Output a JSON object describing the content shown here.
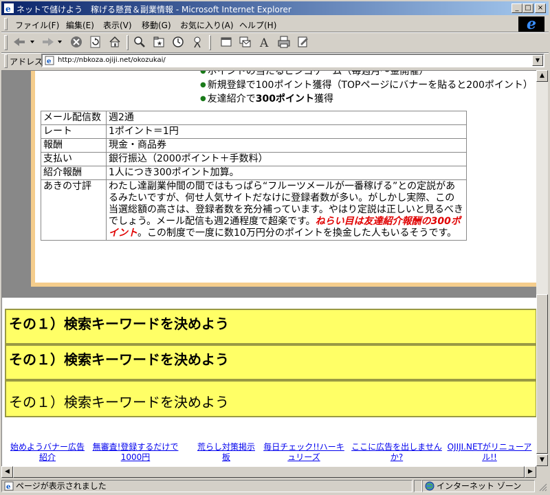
{
  "window": {
    "title": "ネットで儲けよう　稼げる懸賞＆副業情報 - Microsoft Internet Explorer",
    "min_glyph": "_",
    "max_glyph": "□",
    "close_glyph": "×"
  },
  "menu": {
    "items": [
      "ファイル(F)",
      "編集(E)",
      "表示(V)",
      "移動(G)",
      "お気に入り(A)",
      "ヘルプ(H)"
    ]
  },
  "toolbar": {
    "icons": [
      "back-icon",
      "forward-icon",
      "stop-icon",
      "refresh-icon",
      "home-icon",
      "search-icon",
      "favorites-icon",
      "history-icon",
      "channels-icon",
      "fullscreen-icon",
      "mail-icon",
      "font-icon",
      "print-icon",
      "edit-icon"
    ]
  },
  "address": {
    "label": "アドレス",
    "url": "http://nbkoza.ojiji.net/okozukai/"
  },
  "content": {
    "bullets": [
      "ポイントの当たるビンゴゲーム（毎週月～金開催）",
      "新規登録で100ポイント獲得（TOPページにバナーを貼ると200ポイント）",
      "友達紹介で300ポイント獲得"
    ],
    "bullet3_pre": "友達紹介で",
    "bullet3_bold": "300ポイント",
    "bullet3_post": "獲得",
    "table": [
      {
        "key": "メール配信数",
        "value": "週2通"
      },
      {
        "key": "レート",
        "value": "1ポイント＝1円"
      },
      {
        "key": "報酬",
        "value": "現金・商品券"
      },
      {
        "key": "支払い",
        "value": "銀行振込（2000ポイント＋手数料）"
      },
      {
        "key": "紹介報酬",
        "value": "1人につき300ポイント加算。"
      }
    ],
    "review_key": "あきの寸評",
    "review_pre": "わたし達副業仲間の間ではもっぱら“フルーツメールが一番稼げる”との定説があるみたいですが、何せ人気サイトだなけに登録者数が多い。がしかし実際、この当選総額の高さは、登録者数を充分補っています。やはり定説は正しいと見るべきでしょう。メール配信も週2通程度で超楽です。",
    "review_red": "ねらい目は友達紹介報酬の300ポイント",
    "review_post": "。この制度で一度に数10万円分のポイントを換金した人もいるそうです。",
    "headings": [
      "その１）検索キーワードを決めよう",
      "その１）検索キーワードを決めよう",
      "その１）検索キーワードを決めよう"
    ],
    "footer_links": [
      "始めようバナー広告紹介",
      "無審査!登録するだけで1000円",
      "荒らし対策掲示板",
      "毎日チェック!!ハーキュリーズ",
      "ここに広告を出しませんか?",
      "OJIJI.NETがリニューアル!!"
    ]
  },
  "status": {
    "text": "ページが表示されました",
    "zone": "インターネット ゾーン"
  }
}
